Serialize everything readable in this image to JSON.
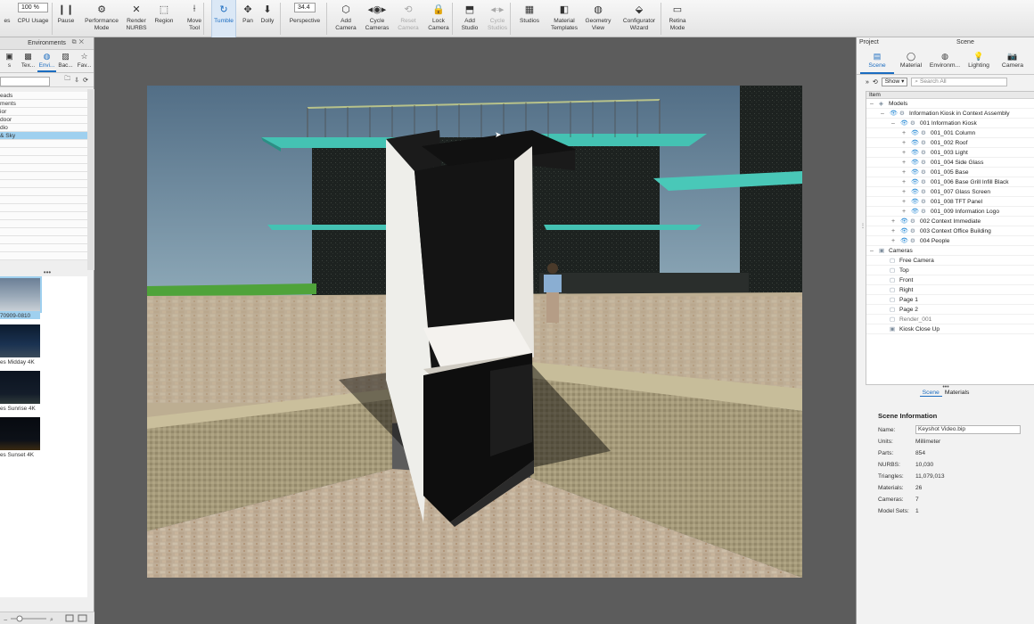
{
  "toolbar": {
    "items": [
      {
        "label": "es",
        "icon": "",
        "type": "plain"
      },
      {
        "label": "CPU Usage",
        "value": "100 %",
        "type": "field"
      },
      {
        "label": "Pause",
        "icon": "❙❙"
      },
      {
        "label": "Performance\nMode",
        "icon": "⚙"
      },
      {
        "label": "Render\nNURBS",
        "icon": "✕"
      },
      {
        "label": "Region",
        "icon": "⬚"
      },
      {
        "label": "Move\nTool",
        "icon": "⟊"
      },
      {
        "label": "Tumble",
        "icon": "↻",
        "active": true
      },
      {
        "label": "Pan",
        "icon": "✥"
      },
      {
        "label": "Dolly",
        "icon": "⬇"
      },
      {
        "label": "Perspective",
        "value": "34.4",
        "type": "field"
      },
      {
        "label": "Add\nCamera",
        "icon": "⬡"
      },
      {
        "label": "Cycle\nCameras",
        "icon": "◂◉▸"
      },
      {
        "label": "Reset\nCamera",
        "icon": "⟲",
        "disabled": true
      },
      {
        "label": "Lock\nCamera",
        "icon": "🔒"
      },
      {
        "label": "Add\nStudio",
        "icon": "⬒"
      },
      {
        "label": "Cycle\nStudios",
        "icon": "◂▫▸",
        "disabled": true
      },
      {
        "label": "Studios",
        "icon": "▦"
      },
      {
        "label": "Material\nTemplates",
        "icon": "◧"
      },
      {
        "label": "Geometry\nView",
        "icon": "◍"
      },
      {
        "label": "Configurator\nWizard",
        "icon": "⬙"
      },
      {
        "label": "Retina\nMode",
        "icon": "▭"
      }
    ]
  },
  "left_panel": {
    "title": "Environments",
    "tabs": [
      {
        "label": "s",
        "icon": "▣"
      },
      {
        "label": "Tex...",
        "icon": "▩"
      },
      {
        "label": "Envi...",
        "icon": "◍",
        "active": true
      },
      {
        "label": "Bac...",
        "icon": "▨"
      },
      {
        "label": "Fav...",
        "icon": "☆"
      }
    ],
    "list": [
      "eads",
      "ments",
      "ior",
      "door",
      "dio",
      "& Sky",
      "",
      "",
      "",
      "",
      "",
      "",
      "",
      "",
      "",
      "",
      "",
      "",
      "",
      "",
      ""
    ],
    "selected_index": 5,
    "thumbnails": [
      {
        "label": "70909-0810",
        "selected": true,
        "gradient": "linear-gradient(#6b7f96 0%, #9aa9b8 55%, #c9d0d6 100%)"
      },
      {
        "label": "es Midday 4K",
        "gradient": "linear-gradient(#0c1b2e 0%, #1a3251 60%, #3a4a5a 100%)"
      },
      {
        "label": "es Sunrise 4K",
        "gradient": "linear-gradient(#0b1320 0%, #141d2a 70%, #2f3a3a 100%)"
      },
      {
        "label": "es Sunset 4K",
        "gradient": "linear-gradient(#070a10 0%, #0d1118 70%, #3a2a12 100%)"
      }
    ]
  },
  "right_panel": {
    "project_label": "Project",
    "scene_label": "Scene",
    "tabs": [
      {
        "label": "Scene",
        "icon": "▤",
        "active": true
      },
      {
        "label": "Material",
        "icon": "◯"
      },
      {
        "label": "Environm...",
        "icon": "◍"
      },
      {
        "label": "Lighting",
        "icon": "💡"
      },
      {
        "label": "Camera",
        "icon": "📷"
      }
    ],
    "show_label": "Show ▾",
    "search_placeholder": "Search All",
    "tree_header": "Item",
    "tree": [
      {
        "label": "Models",
        "depth": 0,
        "exp": "–",
        "eye": false,
        "icon": "◈"
      },
      {
        "label": "Information Kiosk in Context Assembly",
        "depth": 1,
        "exp": "–",
        "eye": true,
        "icon": "⚙"
      },
      {
        "label": "001 Information Kiosk",
        "depth": 2,
        "exp": "–",
        "eye": true,
        "icon": "⚙"
      },
      {
        "label": "001_001 Column",
        "depth": 3,
        "exp": "+",
        "eye": true,
        "icon": "⚙"
      },
      {
        "label": "001_002 Roof",
        "depth": 3,
        "exp": "+",
        "eye": true,
        "icon": "⚙"
      },
      {
        "label": "001_003 Light",
        "depth": 3,
        "exp": "+",
        "eye": true,
        "icon": "⚙"
      },
      {
        "label": "001_004 Side Glass",
        "depth": 3,
        "exp": "+",
        "eye": true,
        "icon": "⚙"
      },
      {
        "label": "001_005 Base",
        "depth": 3,
        "exp": "+",
        "eye": true,
        "icon": "⚙"
      },
      {
        "label": "001_006 Base Grill Infill Black",
        "depth": 3,
        "exp": "+",
        "eye": true,
        "icon": "⚙"
      },
      {
        "label": "001_007 Glass Screen",
        "depth": 3,
        "exp": "+",
        "eye": true,
        "icon": "⚙"
      },
      {
        "label": "001_008 TFT Panel",
        "depth": 3,
        "exp": "+",
        "eye": true,
        "icon": "⚙"
      },
      {
        "label": "001_009 Information Logo",
        "depth": 3,
        "exp": "+",
        "eye": true,
        "icon": "⚙"
      },
      {
        "label": "002 Context Immediate",
        "depth": 2,
        "exp": "+",
        "eye": true,
        "icon": "⚙"
      },
      {
        "label": "003 Context Office Building",
        "depth": 2,
        "exp": "+",
        "eye": true,
        "icon": "⚙"
      },
      {
        "label": "004 People",
        "depth": 2,
        "exp": "+",
        "eye": true,
        "icon": "⚙"
      },
      {
        "label": "Cameras",
        "depth": 0,
        "exp": "–",
        "eye": false,
        "icon": "▣"
      },
      {
        "label": "Free Camera",
        "depth": 1,
        "exp": "",
        "eye": false,
        "icon": "▢"
      },
      {
        "label": "Top",
        "depth": 1,
        "exp": "",
        "eye": false,
        "icon": "▢"
      },
      {
        "label": "Front",
        "depth": 1,
        "exp": "",
        "eye": false,
        "icon": "▢"
      },
      {
        "label": "Right",
        "depth": 1,
        "exp": "",
        "eye": false,
        "icon": "▢"
      },
      {
        "label": "Page 1",
        "depth": 1,
        "exp": "",
        "eye": false,
        "icon": "▢"
      },
      {
        "label": "Page 2",
        "depth": 1,
        "exp": "",
        "eye": false,
        "icon": "▢"
      },
      {
        "label": "Render_001",
        "depth": 1,
        "exp": "",
        "eye": false,
        "icon": "▢",
        "dim": true
      },
      {
        "label": "Kiosk Close Up",
        "depth": 1,
        "exp": "",
        "eye": false,
        "icon": "▣"
      }
    ],
    "bottom_tabs": [
      {
        "label": "Scene",
        "active": true
      },
      {
        "label": "Materials"
      }
    ],
    "scene_info": {
      "heading": "Scene Information",
      "rows": [
        {
          "key": "Name:",
          "value": "Keyshot Video.bip",
          "box": true
        },
        {
          "key": "Units:",
          "value": "Millimeter"
        },
        {
          "key": "Parts:",
          "value": "854"
        },
        {
          "key": "NURBS:",
          "value": "10,030"
        },
        {
          "key": "Triangles:",
          "value": "11,079,013"
        },
        {
          "key": "Materials:",
          "value": "26"
        },
        {
          "key": "Cameras:",
          "value": "7"
        },
        {
          "key": "Model Sets:",
          "value": "1"
        }
      ]
    }
  },
  "colors": {
    "accent": "#1b6cc0",
    "selection": "#9fd0ef",
    "viewport_bg": "#5c5c5c"
  }
}
